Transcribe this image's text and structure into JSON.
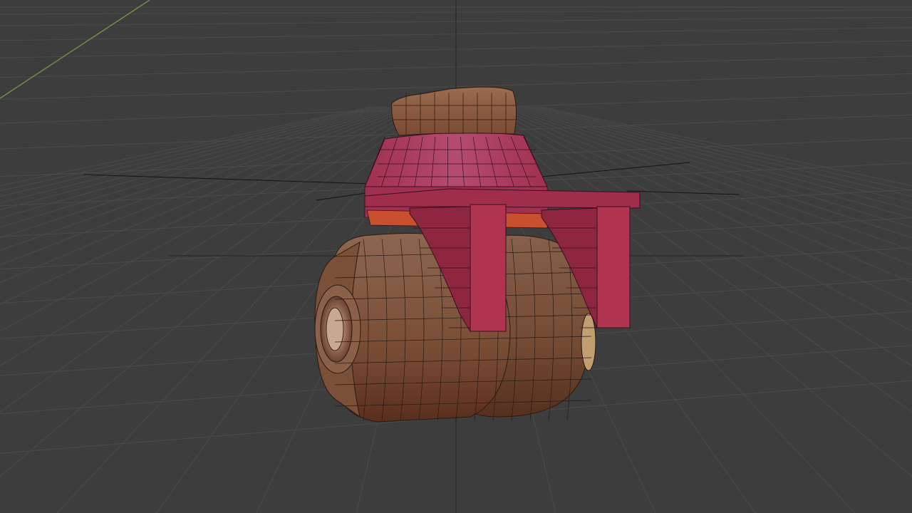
{
  "viewport": {
    "background": "#3d3d3d",
    "grid_color": "#4a4a4a",
    "axis_y_color": "#6f8f3f",
    "axis_z_color": "#2a2a2a",
    "wire_color": "#1a1a1a"
  },
  "model": {
    "top_cap_color": "#8a5a3f",
    "housing_color": "#b03a5e",
    "bracket_color": "#9e2b47",
    "ring_color": "#c8502e",
    "wheel_color": "#8a5a40",
    "wheel_shadow_color": "#5a3828",
    "hub_color": "#a88870"
  }
}
